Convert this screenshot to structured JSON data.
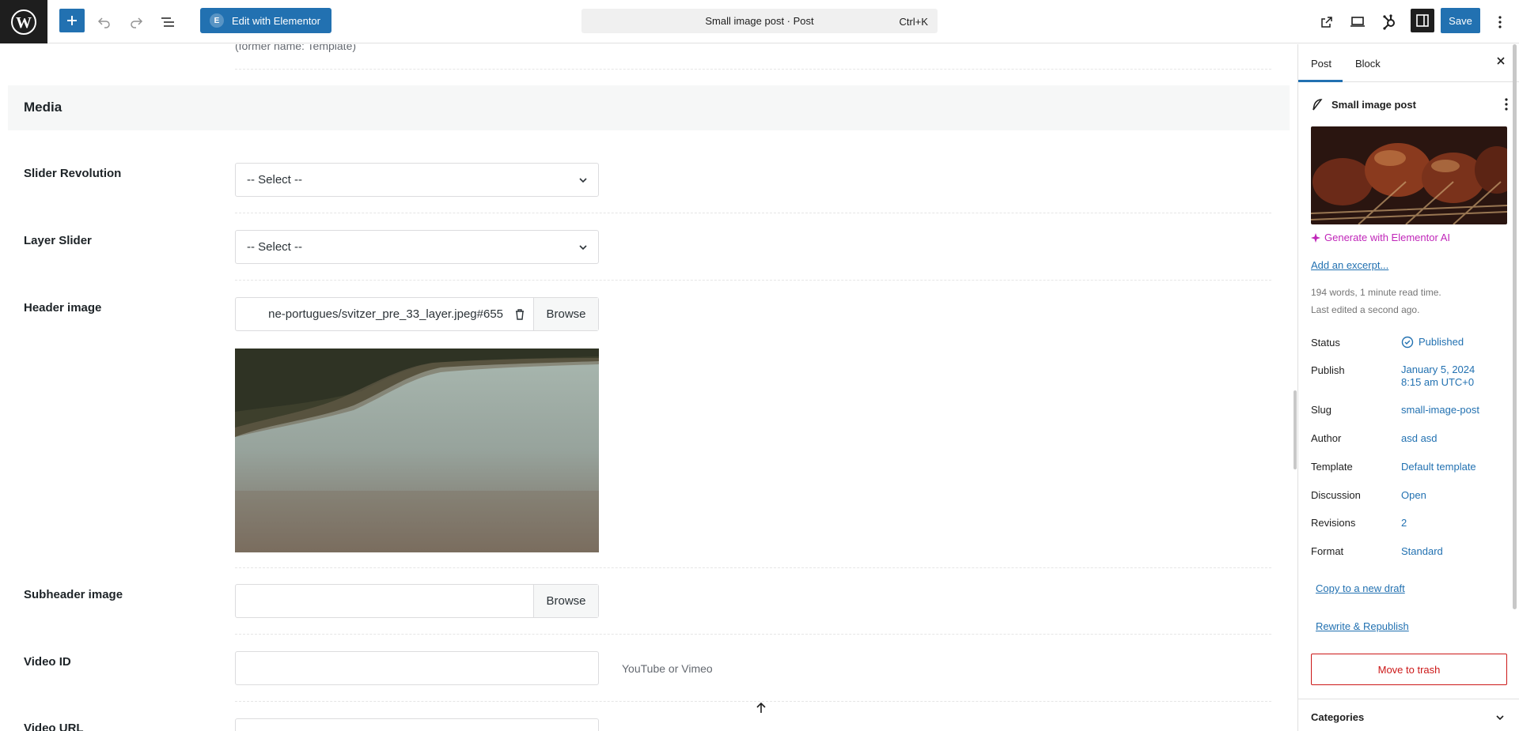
{
  "topbar": {
    "elementor_label": "Edit with Elementor",
    "command_title": "Small image post · Post",
    "command_shortcut": "Ctrl+K",
    "save_label": "Save"
  },
  "main": {
    "former_text": "(former name: Template)",
    "section_title": "Media",
    "fields": {
      "slider_revolution": {
        "label": "Slider Revolution",
        "value": "-- Select --"
      },
      "layer_slider": {
        "label": "Layer Slider",
        "value": "-- Select --"
      },
      "header_image": {
        "label": "Header image",
        "value": "ne-portugues/svitzer_pre_33_layer.jpeg#655",
        "browse": "Browse"
      },
      "subheader_image": {
        "label": "Subheader image",
        "value": "",
        "browse": "Browse"
      },
      "video_id": {
        "label": "Video ID",
        "value": "",
        "hint": "YouTube or Vimeo"
      },
      "video_url": {
        "label": "Video URL"
      }
    }
  },
  "sidebar": {
    "tabs": [
      "Post",
      "Block"
    ],
    "post_name": "Small image post",
    "ai_link": "Generate with Elementor AI",
    "excerpt_link": "Add an excerpt...",
    "word_count": "194 words, 1 minute read time.",
    "last_edited": "Last edited a second ago.",
    "rows": [
      {
        "label": "Status",
        "value": "Published"
      },
      {
        "label": "Publish",
        "value": "January 5, 2024",
        "value2": "8:15 am UTC+0"
      },
      {
        "label": "Slug",
        "value": "small-image-post"
      },
      {
        "label": "Author",
        "value": "asd asd"
      },
      {
        "label": "Template",
        "value": "Default template"
      },
      {
        "label": "Discussion",
        "value": "Open"
      },
      {
        "label": "Revisions",
        "value": "2"
      },
      {
        "label": "Format",
        "value": "Standard"
      }
    ],
    "copy_draft": "Copy to a new draft",
    "rewrite": "Rewrite & Republish",
    "trash": "Move to trash",
    "categories": "Categories"
  },
  "colors": {
    "accent": "#2271b1",
    "ai": "#c026b9",
    "danger": "#cc1818"
  }
}
